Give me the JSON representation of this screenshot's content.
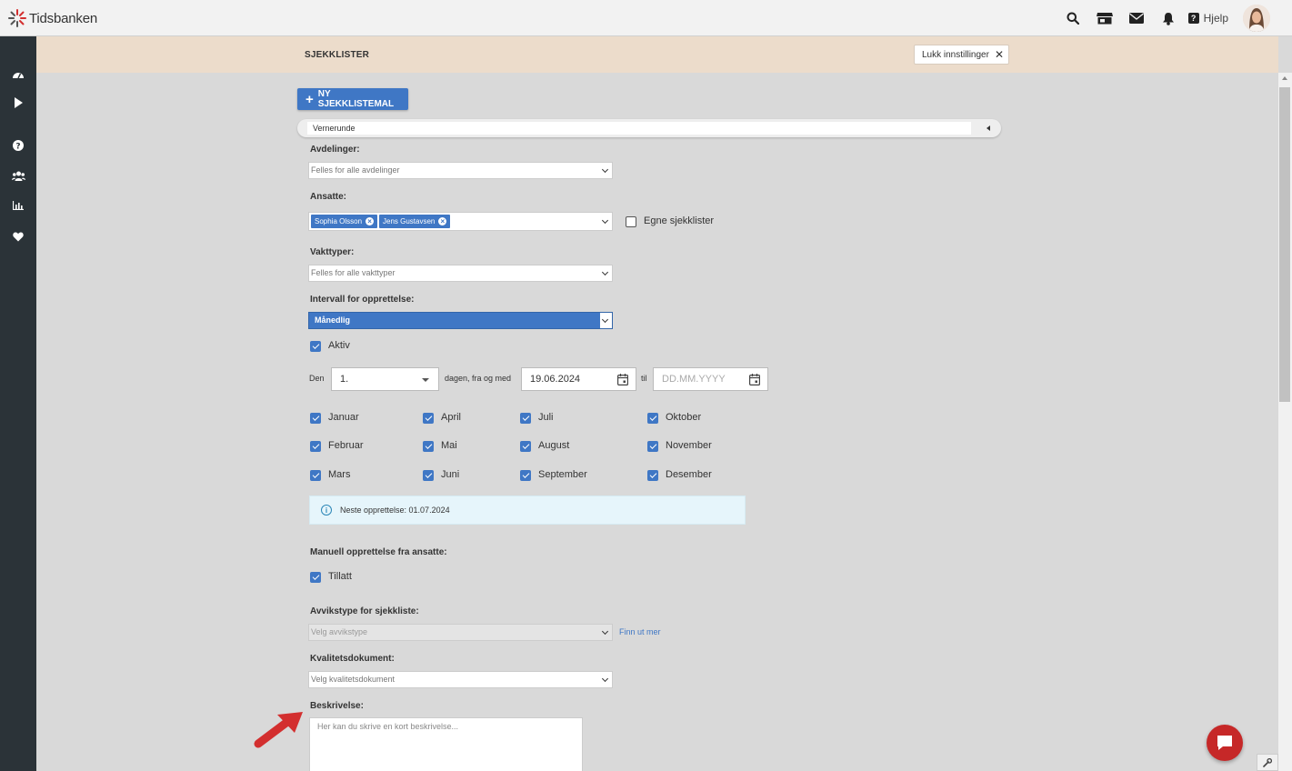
{
  "app": {
    "logo_text": "Tidsbanken",
    "help_label": "Hjelp"
  },
  "header": {
    "title": "SJEKKLISTER",
    "close_label": "Lukk innstillinger"
  },
  "toolbar": {
    "new_template_label": "NY SJEKKLISTEMAL"
  },
  "template": {
    "name": "Vernerunde"
  },
  "form": {
    "departments": {
      "label": "Avdelinger:",
      "value": "Felles for alle avdelinger"
    },
    "employees": {
      "label": "Ansatte:",
      "chips": [
        "Sophia Olsson",
        "Jens Gustavsen"
      ],
      "own_checklists_label": "Egne sjekklister"
    },
    "shift_types": {
      "label": "Vakttyper:",
      "value": "Felles for alle vakttyper"
    },
    "interval": {
      "label": "Intervall for opprettelse:",
      "value": "Månedlig"
    },
    "active_label": "Aktiv",
    "schedule": {
      "prefix": "Den",
      "day": "1.",
      "middle": "dagen, fra og med",
      "from_date": "19.06.2024",
      "to_label": "til",
      "to_placeholder": "DD.MM.YYYY"
    },
    "months": [
      "Januar",
      "April",
      "Juli",
      "Oktober",
      "Februar",
      "Mai",
      "August",
      "November",
      "Mars",
      "Juni",
      "September",
      "Desember"
    ],
    "next_creation": "Neste opprettelse: 01.07.2024",
    "manual": {
      "label": "Manuell opprettelse fra ansatte:",
      "allowed_label": "Tillatt"
    },
    "deviation": {
      "label": "Avvikstype for sjekkliste:",
      "placeholder": "Velg avvikstype",
      "link": "Finn ut mer"
    },
    "quality_doc": {
      "label": "Kvalitetsdokument:",
      "placeholder": "Velg kvalitetsdokument"
    },
    "description": {
      "label": "Beskrivelse:",
      "placeholder": "Her kan du skrive en kort beskrivelse..."
    }
  },
  "colors": {
    "accent": "#3f77c5",
    "sidebar": "#2b3338",
    "header_strip": "#ecdccb",
    "annotation_arrow": "#d32f2f",
    "chat": "#c62828"
  },
  "icons": [
    "search-icon",
    "store-icon",
    "mail-icon",
    "bell-icon",
    "help-icon",
    "dashboard-icon",
    "play-icon",
    "question-icon",
    "users-icon",
    "chart-icon",
    "heart-icon",
    "calendar-icon",
    "info-icon",
    "chat-icon",
    "wrench-icon"
  ]
}
